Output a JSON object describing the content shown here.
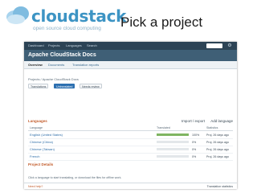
{
  "slide": {
    "brand": "cloudstack",
    "tagline": "open source cloud computing",
    "title": "Pick a project"
  },
  "app": {
    "nav_items": [
      "Dashboard",
      "Projects",
      "Languages",
      "Search"
    ],
    "project_title": "Apache CloudStack Docs",
    "tabs": [
      "Overview",
      "Documents",
      "Translation reports"
    ],
    "breadcrumb": "Projects / Apache CloudStack Docs",
    "filter_buttons": [
      "Translations",
      "Untranslated",
      "Needs review"
    ],
    "languages_heading": "Languages",
    "actions": [
      "Import / export",
      "Add language"
    ],
    "columns": [
      "Language",
      "Translated",
      "Statistics"
    ],
    "rows": [
      {
        "name": "English (United States)",
        "translated": 100,
        "percent": "100%",
        "meta": "Proj. 26 days ago"
      },
      {
        "name": "Chinese (China)",
        "translated": 0,
        "percent": "0%",
        "meta": "Proj. 26 days ago"
      },
      {
        "name": "Chinese (Taiwan)",
        "translated": 0,
        "percent": "0%",
        "meta": "Proj. 26 days ago"
      },
      {
        "name": "French",
        "translated": 0,
        "percent": "0%",
        "meta": "Proj. 26 days ago"
      }
    ],
    "section2_heading": "Project Details",
    "help_text": "Click a language to start translating, or download the files for offline work.",
    "footer_left": "Need help?",
    "footer_right": "Translation statistics"
  },
  "colors": {
    "brand": "#3d94c4",
    "topbar": "#2c4355",
    "progress": "#7fb562"
  }
}
